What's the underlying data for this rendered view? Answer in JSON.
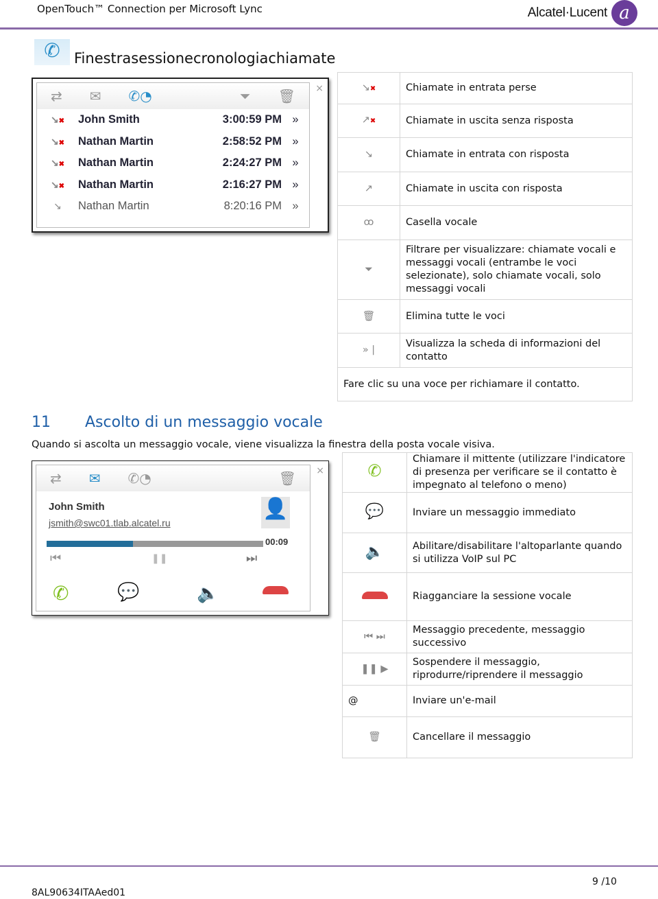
{
  "header": {
    "title": "OpenTouch™ Connection per Microsoft Lync",
    "logo": "Alcatel·Lucent",
    "accent": "#8a6aa8"
  },
  "section1": {
    "title": "Finestrasessionecronologiachiamate",
    "window": {
      "rows": [
        {
          "name": "John Smith",
          "time": "3:00:59 PM",
          "missed": true
        },
        {
          "name": "Nathan Martin",
          "time": "2:58:52 PM",
          "missed": true
        },
        {
          "name": "Nathan Martin",
          "time": "2:24:27 PM",
          "missed": true
        },
        {
          "name": "Nathan Martin",
          "time": "2:16:27 PM",
          "missed": true
        },
        {
          "name": "Nathan Martin",
          "time": "8:20:16 PM",
          "missed": false
        }
      ],
      "details": "»",
      "close": "×"
    },
    "legend": [
      {
        "icon": "missed-incoming-icon",
        "text": "Chiamate in entrata perse"
      },
      {
        "icon": "unanswered-outgoing-icon",
        "text": "Chiamate in uscita senza risposta"
      },
      {
        "icon": "answered-incoming-icon",
        "text": "Chiamate in entrata con risposta"
      },
      {
        "icon": "answered-outgoing-icon",
        "text": "Chiamate in uscita con risposta"
      },
      {
        "icon": "voicemail-icon",
        "text": "Casella vocale"
      },
      {
        "icon": "filter-icon",
        "text": "Filtrare per visualizzare: chiamate vocali e messaggi vocali (entrambe le voci selezionate), solo chiamate vocali, solo messaggi vocali"
      },
      {
        "icon": "trash-icon",
        "text": "Elimina tutte le voci"
      },
      {
        "icon": "details-icon",
        "text": "Visualizza la scheda di informazioni del contatto"
      }
    ],
    "note": "Fare clic su una voce per richiamare il contatto."
  },
  "section2": {
    "number": "11",
    "title": "Ascolto di un messaggio vocale",
    "intro": "Quando si ascolta un messaggio vocale, viene visualizza la finestra della posta vocale visiva.",
    "window": {
      "name": "John Smith",
      "email": "jsmith@swc01.tlab.alcatel.ru",
      "duration": "00:09",
      "progress": 0.4,
      "close": "×"
    },
    "legend": [
      {
        "icon": "call-presence-icon",
        "text": "Chiamare il mittente (utilizzare l'indicatore di presenza per verificare se il contatto è impegnato al telefono o meno)"
      },
      {
        "icon": "instant-message-icon",
        "text": "Inviare un messaggio immediato"
      },
      {
        "icon": "speaker-icon",
        "text": "Abilitare/disabilitare l'altoparlante quando si utilizza VoIP sul PC"
      },
      {
        "icon": "hang-up-icon",
        "text": "Riagganciare la sessione vocale"
      },
      {
        "icon": "prev-next-icon",
        "text": "Messaggio precedente, messaggio successivo"
      },
      {
        "icon": "pause-play-icon",
        "text": "Sospendere il messaggio, riprodurre/riprendere il messaggio"
      },
      {
        "icon": "email-icon",
        "symbol": "@",
        "text": "Inviare un'e-mail"
      },
      {
        "icon": "trash-icon",
        "text": "Cancellare il messaggio"
      }
    ]
  },
  "footer": {
    "doc_id": "8AL90634ITAAed01",
    "page": "9 /10"
  }
}
